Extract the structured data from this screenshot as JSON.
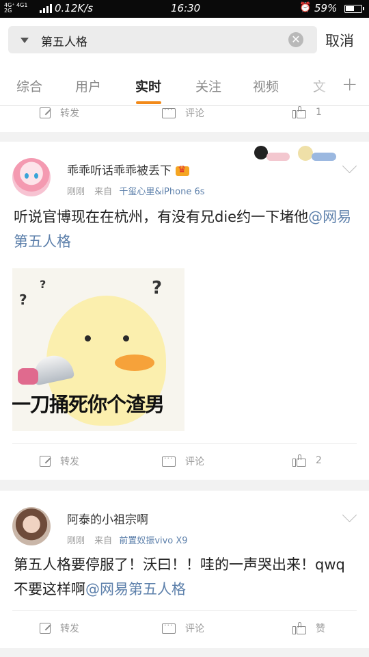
{
  "status_bar": {
    "signal": "4G⁺ 4G1\n2G",
    "net2": "2G",
    "speed": "0.12K/s",
    "time": "16:30",
    "alarm_icon": "alarm-clock-icon",
    "battery_pct": "59%",
    "battery_level": 0.59
  },
  "search": {
    "query": "第五人格",
    "clear_icon": "✕",
    "cancel_label": "取消"
  },
  "tabs": [
    {
      "label": "综合"
    },
    {
      "label": "用户"
    },
    {
      "label": "实时"
    },
    {
      "label": "关注"
    },
    {
      "label": "视频"
    },
    {
      "label": "文"
    }
  ],
  "tabs_plus": "+",
  "accent_color": "#f28a1a",
  "link_color": "#5d80ab",
  "prev_actions": {
    "forward": "转发",
    "comment": "评论",
    "like_count": "1"
  },
  "posts": [
    {
      "username": "乖乖听话乖乖被丢下",
      "time": "刚刚",
      "from": "来自",
      "source": "千玺心里&iPhone 6s",
      "text": "听说官博现在在杭州，有没有兄die约一下堵他",
      "mention": "@网易第五人格",
      "sticker_caption": "一刀捅死你个渣男",
      "forward": "转发",
      "comment": "评论",
      "like_count": "2"
    },
    {
      "username": "阿泰的小祖宗啊",
      "time": "刚刚",
      "from": "来自",
      "source": "前置奴振vivo X9",
      "text": "第五人格要停服了！沃曰！！哇的一声哭出来！qwq不要这样啊",
      "mention": "@网易第五人格",
      "forward": "转发",
      "comment": "评论",
      "like_label": "赞"
    }
  ]
}
